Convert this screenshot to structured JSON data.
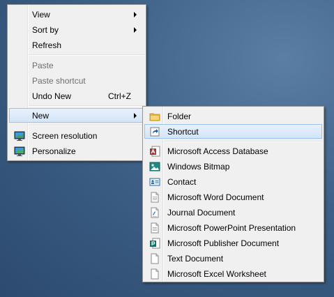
{
  "context_menu": {
    "items": [
      {
        "label": "View",
        "submenu": true
      },
      {
        "label": "Sort by",
        "submenu": true
      },
      {
        "label": "Refresh"
      },
      {
        "label": "Paste",
        "disabled": true
      },
      {
        "label": "Paste shortcut",
        "disabled": true
      },
      {
        "label": "Undo New",
        "shortcut": "Ctrl+Z"
      },
      {
        "label": "New",
        "submenu": true,
        "highlighted": true
      },
      {
        "label": "Screen resolution",
        "icon": "monitor-icon"
      },
      {
        "label": "Personalize",
        "icon": "monitor-icon"
      }
    ]
  },
  "new_submenu": {
    "items": [
      {
        "label": "Folder",
        "icon": "folder-icon"
      },
      {
        "label": "Shortcut",
        "icon": "shortcut-icon",
        "highlighted": true
      },
      {
        "label": "Microsoft Access Database",
        "icon": "access-icon"
      },
      {
        "label": "Windows Bitmap",
        "icon": "bitmap-icon"
      },
      {
        "label": "Contact",
        "icon": "contact-icon"
      },
      {
        "label": "Microsoft Word Document",
        "icon": "document-icon"
      },
      {
        "label": "Journal Document",
        "icon": "journal-icon"
      },
      {
        "label": "Microsoft PowerPoint Presentation",
        "icon": "document-icon"
      },
      {
        "label": "Microsoft Publisher Document",
        "icon": "publisher-icon"
      },
      {
        "label": "Text Document",
        "icon": "document-icon"
      },
      {
        "label": "Microsoft Excel Worksheet",
        "icon": "document-icon"
      }
    ]
  },
  "colors": {
    "desktop": "#3e6188",
    "menu_bg": "#f0f0f0",
    "highlight_border": "#9cc3ec",
    "disabled_text": "#6d6d6d"
  }
}
